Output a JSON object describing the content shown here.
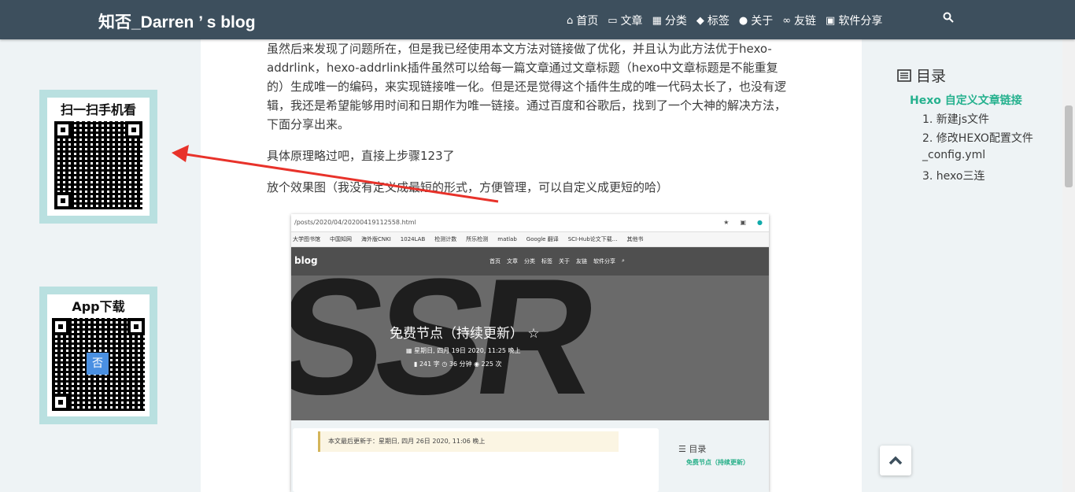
{
  "navbar": {
    "brand": "知否_Darren ’ s blog",
    "items": [
      {
        "icon": "home-icon",
        "glyph": "⌂",
        "label": "首页"
      },
      {
        "icon": "archive-icon",
        "glyph": "▭",
        "label": "文章"
      },
      {
        "icon": "grid-icon",
        "glyph": "▦",
        "label": "分类"
      },
      {
        "icon": "tags-icon",
        "glyph": "◆",
        "label": "标签"
      },
      {
        "icon": "user-icon",
        "glyph": "●",
        "label": "关于"
      },
      {
        "icon": "link-icon",
        "glyph": "∞",
        "label": "友链"
      },
      {
        "icon": "apps-icon",
        "glyph": "▣",
        "label": "软件分享"
      }
    ],
    "search_icon": "search-icon"
  },
  "qr": {
    "mobile_title": "扫一扫手机看",
    "app_title": "App下载",
    "app_logo": "否"
  },
  "article": {
    "p1": "虽然后来发现了问题所在，但是我已经使用本文方法对链接做了优化，并且认为此方法优于hexo-addrlink，hexo-addrlink插件虽然可以给每一篇文章通过文章标题（hexo中文章标题是不能重复的）生成唯一的编码，来实现链接唯一化。但是还是觉得这个插件生成的唯一代码太长了，也没有逻辑，我还是希望能够用时间和日期作为唯一链接。通过百度和谷歌后，找到了一个大神的解决方法，下面分享出来。",
    "p2": "具体原理略过吧，直接上步骤123了",
    "p3": "放个效果图（我没有定义成最短的形式，方便管理，可以自定义成更短的哈）"
  },
  "screenshot": {
    "url": "/posts/2020/04/20200419112558.html",
    "bookmarks": [
      "大学图书馆",
      "中国知网",
      "海外版CNKI",
      "1024LAB",
      "检测计数",
      "所乐检测",
      "matlab",
      "Google 翻译",
      "SCI-Hub论文下载...",
      "其他书"
    ],
    "brand": "blog",
    "menu": [
      "首页",
      "文章",
      "分类",
      "标签",
      "关于",
      "友链",
      "软件分享"
    ],
    "title": "免费节点（持续更新）",
    "meta_date": "星期日, 四月 19日 2020, 11:25 晚上",
    "meta_words": "241 字",
    "meta_time": "36 分钟",
    "meta_views": "225 次",
    "note": "本文最后更新于：星期日, 四月 26日 2020, 11:06 晚上",
    "toc_title": "目录",
    "toc_item": "免费节点（持续更新）"
  },
  "toc": {
    "title": "目录",
    "main": "Hexo 自定义文章链接",
    "items": [
      "1. 新建js文件",
      "2. 修改HEXO配置文件",
      "_config.yml",
      "3. hexo三连"
    ]
  },
  "colors": {
    "navbar": "#3d4f5d",
    "accent": "#25b18e",
    "qr_frame": "#b9e0e0",
    "arrow": "#e8322a"
  }
}
